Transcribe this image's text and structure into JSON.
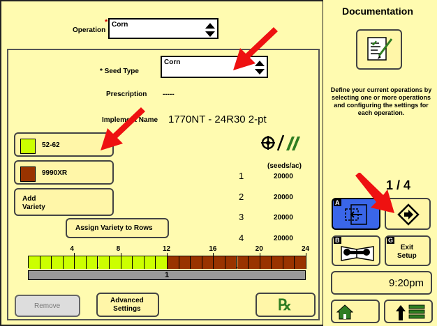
{
  "operation": {
    "label": "Operation",
    "value": "Corn"
  },
  "seed_type": {
    "label": "* Seed Type",
    "value": "Corn"
  },
  "prescription": {
    "label": "Prescription",
    "value": "-----"
  },
  "implement": {
    "label": "Implement Name",
    "value": "1770NT - 24R30 2-pt"
  },
  "varieties": [
    {
      "label": "52-62",
      "color": "#ccff00"
    },
    {
      "label": "9990XR",
      "color": "#993300"
    }
  ],
  "buttons": {
    "add_variety": "Add\nVariety",
    "assign_variety": "Assign Variety to Rows",
    "remove": "Remove",
    "advanced": "Advanced\nSettings"
  },
  "rates": {
    "header": "(seeds/ac)",
    "rows": [
      {
        "num": "1",
        "val": "20000"
      },
      {
        "num": "2",
        "val": "20000"
      },
      {
        "num": "3",
        "val": "20000"
      },
      {
        "num": "4",
        "val": "20000"
      }
    ]
  },
  "row_bar": {
    "ticks": [
      "4",
      "8",
      "12",
      "16",
      "20",
      "24"
    ],
    "total_rows": 24,
    "variety_1_rows": 12,
    "section_label": "1"
  },
  "right": {
    "title": "Documentation",
    "description": "Define your current operations by selecting one or more operations and configuring the settings for each operation.",
    "page": "1 / 4",
    "exit": "Exit\nSetup",
    "time": "9:20pm",
    "key_a": "A",
    "key_b": "B",
    "key_g": "G"
  },
  "colors": {
    "background": "#fffbb0",
    "selected_blue": "#3a66e8",
    "arrow_red": "#ee1111"
  }
}
